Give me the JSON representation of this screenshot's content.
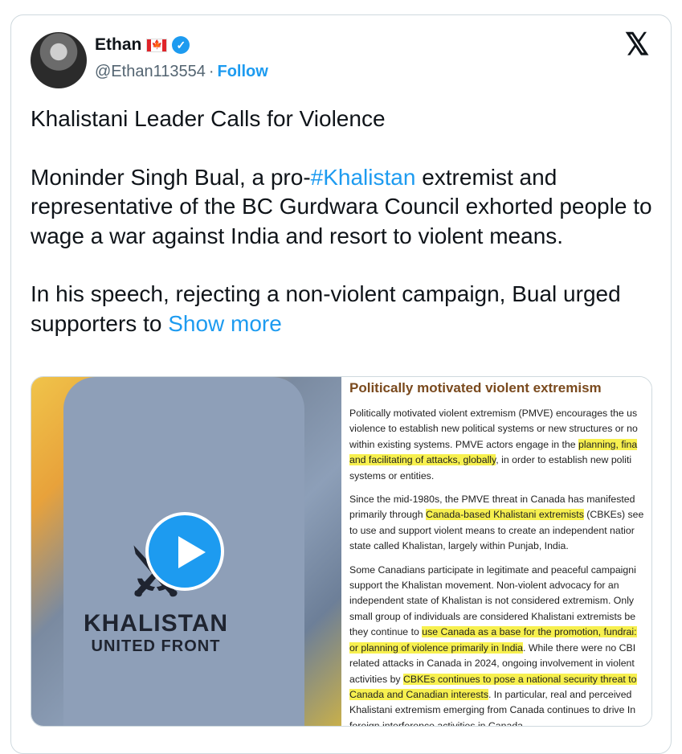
{
  "author": {
    "name": "Ethan",
    "flag": "🍁",
    "handle": "@Ethan113554",
    "separator": "·",
    "follow_label": "Follow"
  },
  "x_logo": "𝕏",
  "tweet": {
    "line1": "Khalistani Leader Calls for Violence",
    "p2_before": "Moninder Singh Bual, a pro-",
    "p2_hashtag": "#Khalistan",
    "p2_after": " extremist and representative of the BC Gurdwara Council exhorted people to wage a war against India and resort to violent means.",
    "p3_text": "In his speech, rejecting a non-violent campaign, Bual urged supporters to ",
    "show_more": "Show more"
  },
  "media": {
    "emblem_line1": "KHALISTAN",
    "emblem_line2": "UNITED FRONT",
    "doc_title": "Politically motivated violent extremism",
    "doc_lines": [
      [
        "Politically motivated violent extremism (PMVE) encourages the us",
        ""
      ],
      [
        "violence to establish new political systems or new structures or no",
        ""
      ],
      [
        "within existing systems. PMVE actors engage in the ",
        "planning, fina"
      ],
      [
        "and facilitating of attacks, globally",
        ", in order to establish new politi"
      ],
      [
        "systems or entities.",
        ""
      ]
    ],
    "doc_p2": [
      [
        "Since the mid-1980s, the PMVE threat in Canada has manifested",
        ""
      ],
      [
        "primarily through ",
        "Canada-based Khalistani extremists",
        " (CBKEs) see"
      ],
      [
        "to use and support violent means to create an independent natior",
        ""
      ],
      [
        "state called Khalistan, largely within Punjab, India.",
        ""
      ]
    ],
    "doc_p3": [
      [
        "Some Canadians participate in legitimate and peaceful campaigni",
        ""
      ],
      [
        "support the Khalistan movement. Non-violent advocacy for an",
        ""
      ],
      [
        "independent state of Khalistan is not considered extremism. Only",
        ""
      ],
      [
        "small group of individuals are considered Khalistani extremists be",
        ""
      ],
      [
        "they continue to ",
        "use Canada as a base for the promotion, fundrai:",
        ""
      ],
      [
        "",
        "or planning of violence primarily in India",
        ". While there were no CBI"
      ],
      [
        "related attacks in Canada in 2024, ongoing involvement in violent",
        ""
      ],
      [
        "activities by ",
        "CBKEs continues to pose a national security threat to",
        ""
      ],
      [
        "",
        "Canada and Canadian interests",
        ". In particular, real and perceived"
      ],
      [
        "Khalistani extremism emerging from Canada continues to drive In",
        ""
      ],
      [
        "foreign interference activities in Canada.",
        ""
      ]
    ]
  }
}
